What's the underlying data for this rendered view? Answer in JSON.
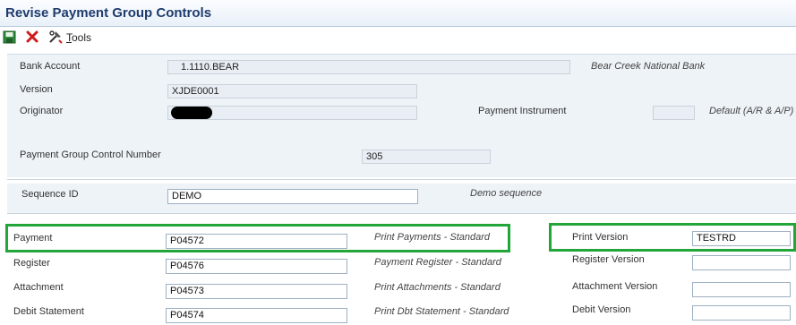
{
  "window": {
    "title": "Revise Payment Group Controls"
  },
  "toolbar": {
    "save_icon": "save-icon",
    "cancel_icon": "close-icon",
    "tools_icon": "tools-icon",
    "tools_label_underlined": "T",
    "tools_label_rest": "ools"
  },
  "header": {
    "bank_account_label": "Bank Account",
    "bank_account_value": "1.1110.BEAR",
    "bank_name": "Bear Creek National Bank",
    "version_label": "Version",
    "version_value": "XJDE0001",
    "originator_label": "Originator",
    "payment_instrument_label": "Payment Instrument",
    "payment_instrument_value": "",
    "payment_instrument_desc": "Default (A/R & A/P)",
    "pgc_number_label": "Payment Group Control Number",
    "pgc_number_value": "305"
  },
  "sequence": {
    "label": "Sequence ID",
    "value": "DEMO",
    "desc": "Demo sequence"
  },
  "programs": {
    "payment_label": "Payment",
    "payment_value": "P04572",
    "payment_desc": "Print Payments - Standard",
    "register_label": "Register",
    "register_value": "P04576",
    "register_desc": "Payment Register - Standard",
    "attachment_label": "Attachment",
    "attachment_value": "P04573",
    "attachment_desc": "Print Attachments - Standard",
    "debit_label": "Debit Statement",
    "debit_value": "P04574",
    "debit_desc": "Print Dbt Statement - Standard"
  },
  "versions": {
    "print_label": "Print Version",
    "print_value": "TESTRD",
    "register_label": "Register Version",
    "register_value": "",
    "attachment_label": "Attachment Version",
    "attachment_value": "",
    "debit_label": "Debit Version",
    "debit_value": ""
  },
  "colors": {
    "title": "#1f3c6e",
    "highlight": "#22a63a",
    "panel": "#eef3f8"
  }
}
